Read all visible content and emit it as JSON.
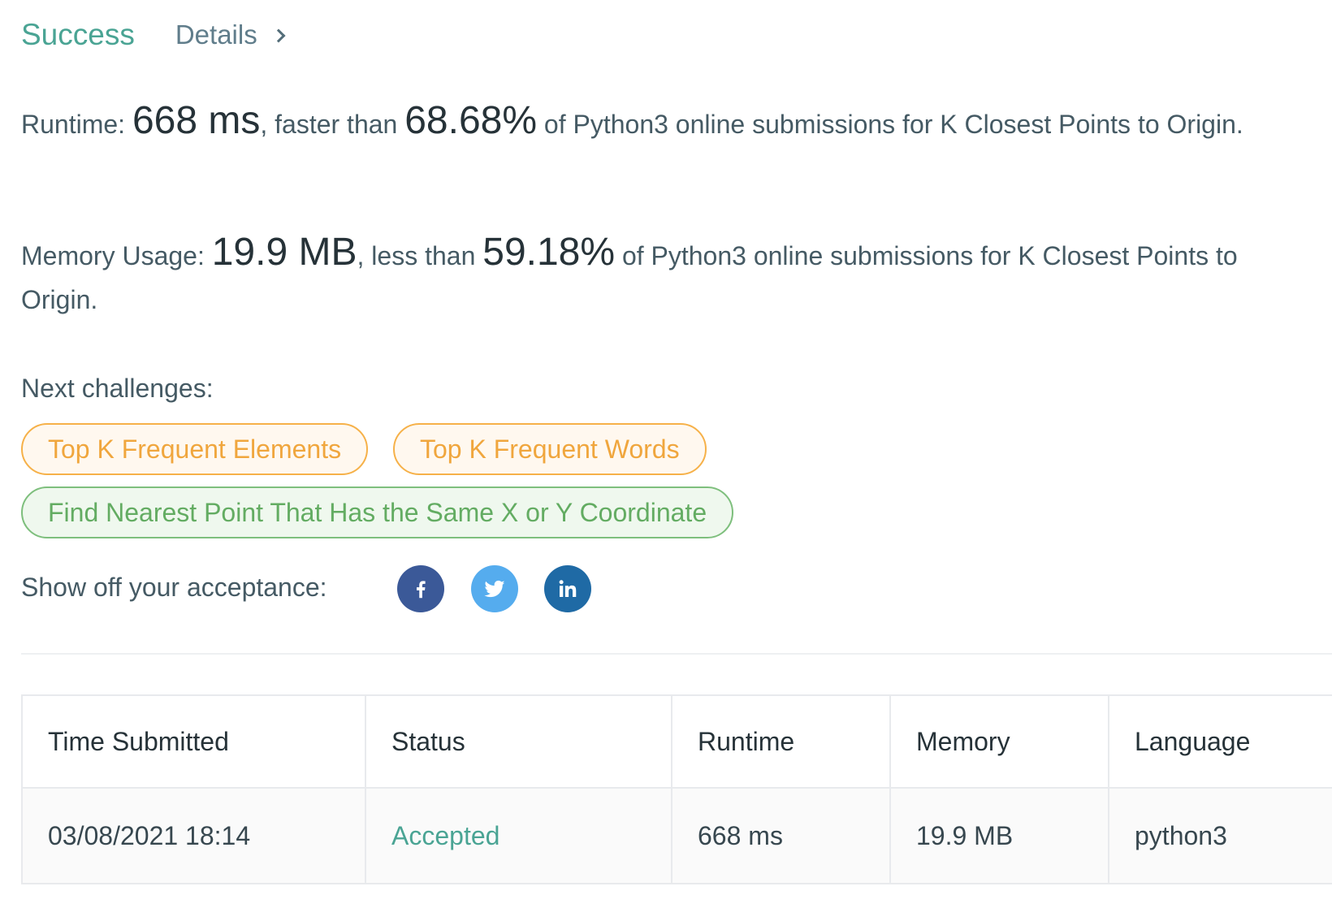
{
  "header": {
    "status": "Success",
    "details_label": "Details"
  },
  "runtime_result": {
    "label": "Runtime:",
    "value": "668 ms",
    "comparison": ", faster than",
    "percent": "68.68%",
    "suffix": "of Python3 online submissions for K Closest Points to Origin."
  },
  "memory_result": {
    "label": "Memory Usage:",
    "value": "19.9 MB",
    "comparison": ", less than",
    "percent": "59.18%",
    "suffix": "of Python3 online submissions for K Closest Points to Origin."
  },
  "next_challenges": {
    "label": "Next challenges:",
    "items": [
      {
        "title": "Top K Frequent Elements",
        "difficulty_color": "#f0a63d"
      },
      {
        "title": "Top K Frequent Words",
        "difficulty_color": "#f0a63d"
      },
      {
        "title": "Find Nearest Point That Has the Same X or Y Coordinate",
        "difficulty_color": "#63ac62"
      }
    ]
  },
  "share": {
    "label": "Show off your acceptance:",
    "icons": [
      "facebook-icon",
      "twitter-icon",
      "linkedin-icon"
    ]
  },
  "submissions": {
    "headers": [
      "Time Submitted",
      "Status",
      "Runtime",
      "Memory",
      "Language"
    ],
    "rows": [
      {
        "time": "03/08/2021 18:14",
        "status": "Accepted",
        "runtime": "668 ms",
        "memory": "19.9 MB",
        "language": "python3"
      }
    ]
  },
  "colors": {
    "success": "#4aa494",
    "medium": "#f0a63d",
    "easy": "#63ac62",
    "facebook": "#3b5998",
    "twitter": "#55acee",
    "linkedin": "#1f6aa5"
  }
}
